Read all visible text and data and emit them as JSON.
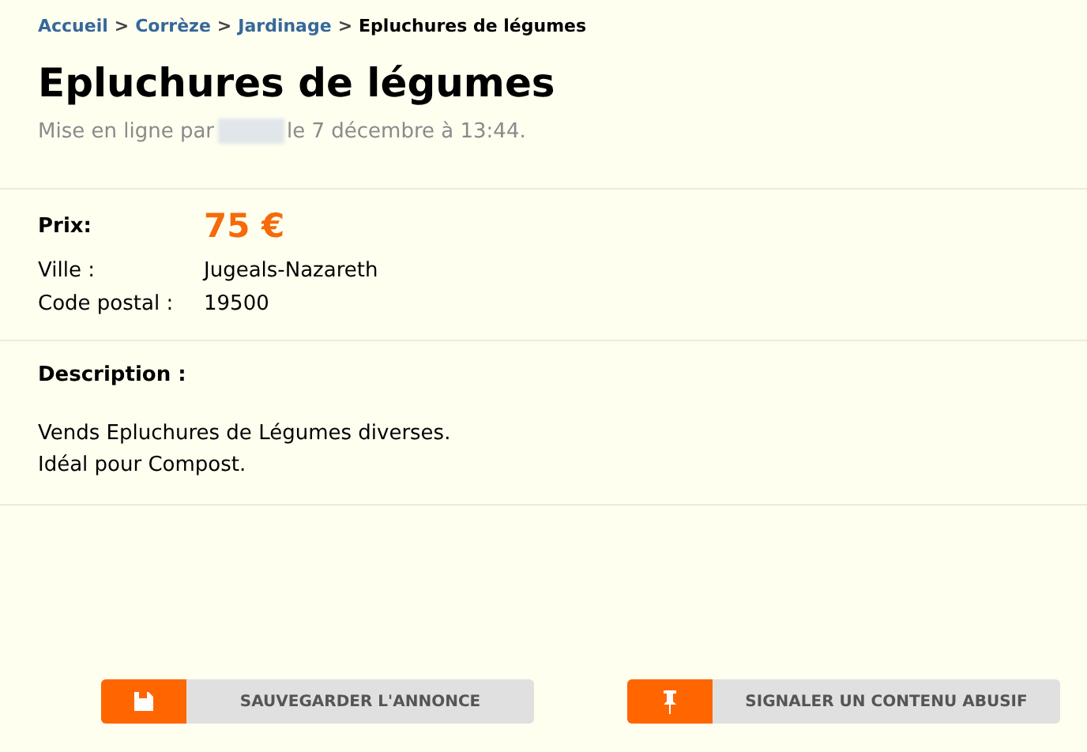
{
  "breadcrumb": [
    {
      "label": "Accueil",
      "kind": "link"
    },
    {
      "label": "Corrèze",
      "kind": "link"
    },
    {
      "label": "Jardinage",
      "kind": "link"
    },
    {
      "label": "Epluchures de légumes",
      "kind": "current"
    }
  ],
  "breadcrumb_separator": ">",
  "title": "Epluchures de légumes",
  "posted": {
    "before": "Mise en ligne par",
    "after": "le 7 décembre à 13:44."
  },
  "price": {
    "label": "Prix:",
    "value": "75 €"
  },
  "details": [
    {
      "label": "Ville :",
      "value": "Jugeals-Nazareth"
    },
    {
      "label": "Code postal :",
      "value": "19500"
    }
  ],
  "description": {
    "label": "Description :",
    "lines": [
      "Vends Epluchures de Légumes diverses.",
      "Idéal pour Compost."
    ]
  },
  "buttons": [
    {
      "label": "SAUVEGARDER L'ANNONCE",
      "kind": "save"
    },
    {
      "label": "SIGNALER UN CONTENU ABUSIF",
      "kind": "report"
    }
  ]
}
